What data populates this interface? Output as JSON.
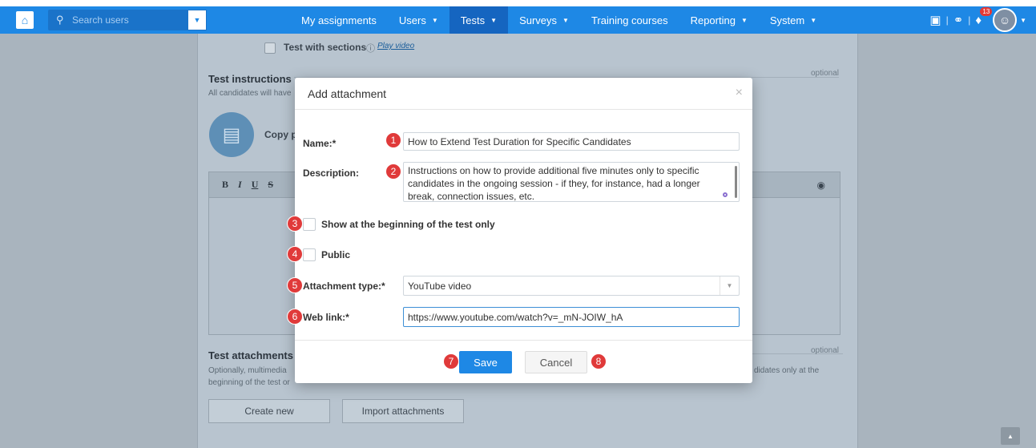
{
  "topbar": {
    "search_placeholder": "Search users",
    "nav": [
      {
        "label": "My assignments",
        "has_caret": false,
        "active": false
      },
      {
        "label": "Users",
        "has_caret": true,
        "active": false
      },
      {
        "label": "Tests",
        "has_caret": true,
        "active": true
      },
      {
        "label": "Surveys",
        "has_caret": true,
        "active": false
      },
      {
        "label": "Training courses",
        "has_caret": false,
        "active": false
      },
      {
        "label": "Reporting",
        "has_caret": true,
        "active": false
      },
      {
        "label": "System",
        "has_caret": true,
        "active": false
      }
    ],
    "notification_count": "13",
    "accent_color": "#1e88e5"
  },
  "background": {
    "test_with_sections": "Test with sections",
    "play_video": "Play video",
    "instructions_title": "Test instructions",
    "instructions_desc": "All candidates will have",
    "optional": "optional",
    "copy_label": "Copy p",
    "editor_buttons": [
      "B",
      "I",
      "U",
      "S"
    ],
    "attachments_title": "Test attachments",
    "attachments_desc_1": "Optionally, multimedia",
    "attachments_desc_2": "beginning of the test or",
    "attachments_desc_right": "didates only at the",
    "create_new": "Create new",
    "import_attachments": "Import attachments"
  },
  "modal": {
    "title": "Add attachment",
    "name_label": "Name:*",
    "name_value": "How to Extend Test Duration for Specific Candidates",
    "description_label": "Description:",
    "description_value": "Instructions on how to provide additional five minutes only to specific candidates in the ongoing session - if they, for instance, had a longer break, connection issues, etc.",
    "show_beginning_label": "Show at the beginning of the test only",
    "public_label": "Public",
    "attachment_type_label": "Attachment type:*",
    "attachment_type_value": "YouTube video",
    "web_link_label": "Web link:*",
    "web_link_value": "https://www.youtube.com/watch?v=_mN-JOIW_hA",
    "save_label": "Save",
    "cancel_label": "Cancel"
  },
  "markers": [
    "1",
    "2",
    "3",
    "4",
    "5",
    "6",
    "7",
    "8"
  ]
}
